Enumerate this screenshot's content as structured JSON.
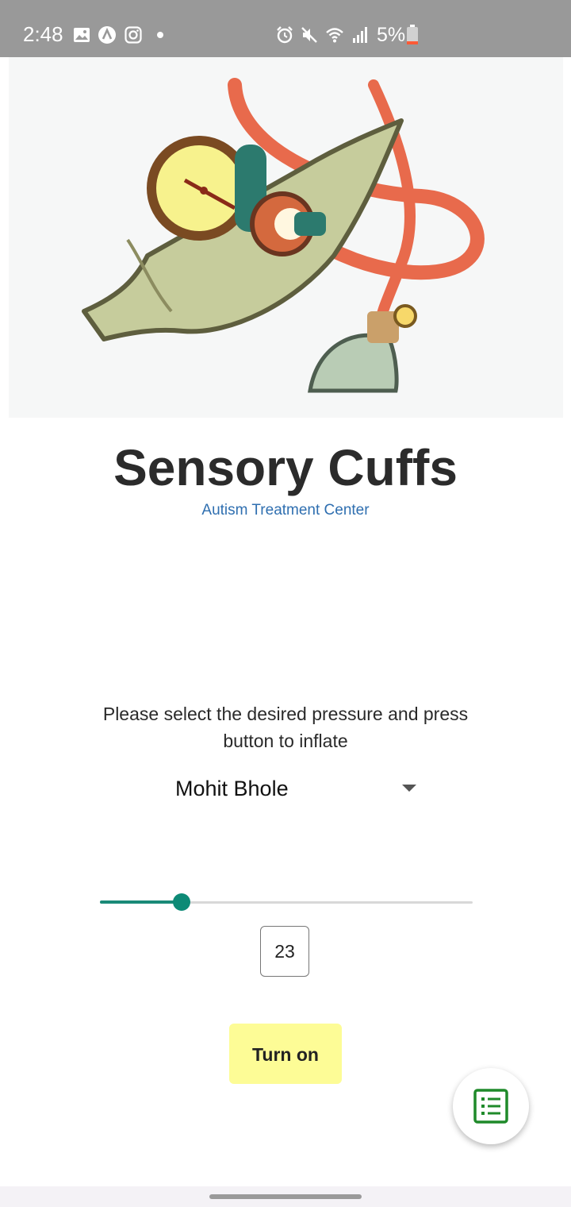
{
  "status_bar": {
    "time": "2:48",
    "battery_percent": "5%",
    "left_icons": [
      "image-icon",
      "app-a-icon",
      "instagram-icon",
      "dot-icon"
    ],
    "right_icons": [
      "alarm-icon",
      "mute-icon",
      "wifi-icon",
      "signal-icon",
      "battery-icon"
    ],
    "battery_color": "#ff5a36"
  },
  "hero": {
    "illustration": "blood-pressure-cuff-illustration"
  },
  "header": {
    "title": "Sensory Cuffs",
    "subtitle": "Autism Treatment Center"
  },
  "main": {
    "instructions": "Please select the desired pressure and press button to inflate",
    "user_select": {
      "selected": "Mohit Bhole"
    },
    "pressure": {
      "value": "23",
      "fraction": 0.22
    },
    "turn_on_label": "Turn on"
  },
  "fab": {
    "icon": "list-icon"
  },
  "colors": {
    "accent": "#0d8a76",
    "button_bg": "#fdfc96",
    "subtitle": "#2f6fb0",
    "fab_icon": "#1f8a2a"
  }
}
